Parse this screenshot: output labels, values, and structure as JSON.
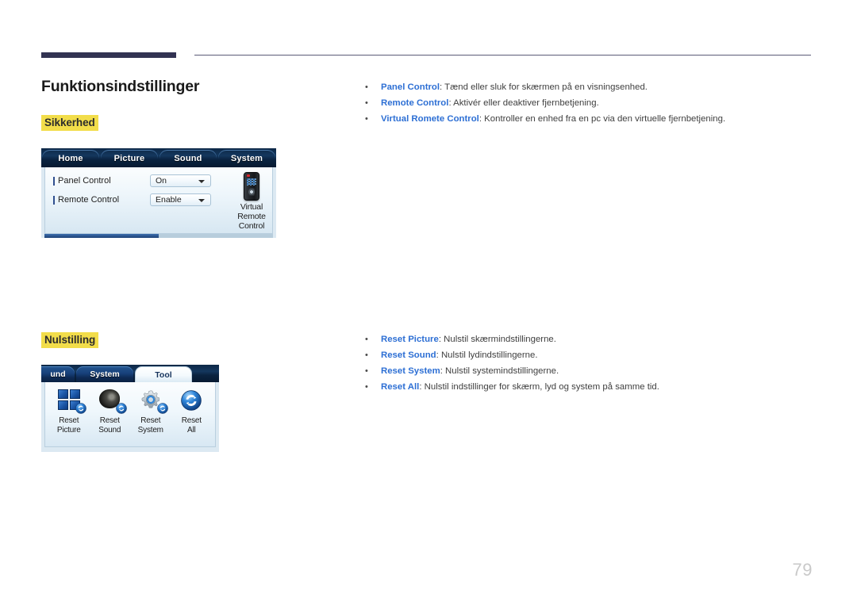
{
  "document": {
    "page_number": "79",
    "title": "Funktionsindstillinger"
  },
  "sections": [
    {
      "heading": "Sikkerhed",
      "bullets": [
        {
          "term": "Panel Control",
          "desc": ": Tænd eller sluk for skærmen på en visningsenhed."
        },
        {
          "term": "Remote Control",
          "desc": ": Aktivér eller deaktiver fjernbetjening."
        },
        {
          "term": "Virtual Romete Control",
          "desc": ": Kontroller en enhed fra en pc via den virtuelle fjernbetjening."
        }
      ]
    },
    {
      "heading": "Nulstilling",
      "bullets": [
        {
          "term": "Reset Picture",
          "desc": ": Nulstil skærmindstillingerne."
        },
        {
          "term": "Reset Sound",
          "desc": ": Nulstil lydindstillingerne."
        },
        {
          "term": "Reset System",
          "desc": ": Nulstil systemindstillingerne."
        },
        {
          "term": "Reset All",
          "desc": ": Nulstil indstillinger for skærm, lyd og system på samme tid."
        }
      ]
    }
  ],
  "osd_security": {
    "tabs": [
      {
        "label": "Home",
        "active": false
      },
      {
        "label": "Picture",
        "active": false
      },
      {
        "label": "Sound",
        "active": false
      },
      {
        "label": "System",
        "active": true
      }
    ],
    "rows": [
      {
        "label": "Panel Control",
        "value": "On"
      },
      {
        "label": "Remote Control",
        "value": "Enable"
      }
    ],
    "virtual_remote": {
      "caption_line1": "Virtual Remote",
      "caption_line2": "Control",
      "icon": "remote-control-icon"
    }
  },
  "osd_reset": {
    "tabs": [
      {
        "label": "und",
        "active": false
      },
      {
        "label": "System",
        "active": false
      },
      {
        "label": "Tool",
        "active": true
      }
    ],
    "items": [
      {
        "line1": "Reset",
        "line2": "Picture",
        "icon": "reset-picture-icon"
      },
      {
        "line1": "Reset",
        "line2": "Sound",
        "icon": "reset-sound-icon"
      },
      {
        "line1": "Reset",
        "line2": "System",
        "icon": "reset-system-icon"
      },
      {
        "line1": "Reset",
        "line2": "All",
        "icon": "reset-all-icon"
      }
    ]
  },
  "colors": {
    "rule": "#323352",
    "highlight": "#f2dd4a",
    "term": "#2d6fd4",
    "osd_tabbar": "#0d2847",
    "page_number": "#c9c9c9"
  }
}
